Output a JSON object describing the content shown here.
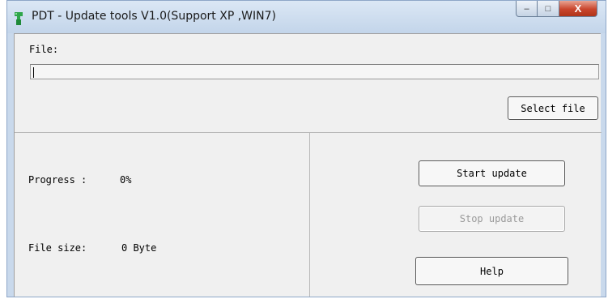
{
  "window": {
    "title": "PDT - Update tools V1.0(Support XP ,WIN7)",
    "icon": "app-green-icon",
    "controls": {
      "minimize": "–",
      "maximize": "□",
      "close": "X"
    }
  },
  "file_section": {
    "label": "File:",
    "path_value": "",
    "select_button": "Select file"
  },
  "status": {
    "progress_label": "Progress :",
    "progress_value": "0%",
    "filesize_label": "File size:",
    "filesize_value": "0 Byte"
  },
  "actions": {
    "start": "Start update",
    "stop": "Stop update",
    "stop_disabled": true,
    "help": "Help"
  },
  "colors": {
    "title_bar": "#c9d9ec",
    "client_bg": "#f0f0f0",
    "close_button": "#c9452c",
    "app_icon": "#2fa64a"
  }
}
